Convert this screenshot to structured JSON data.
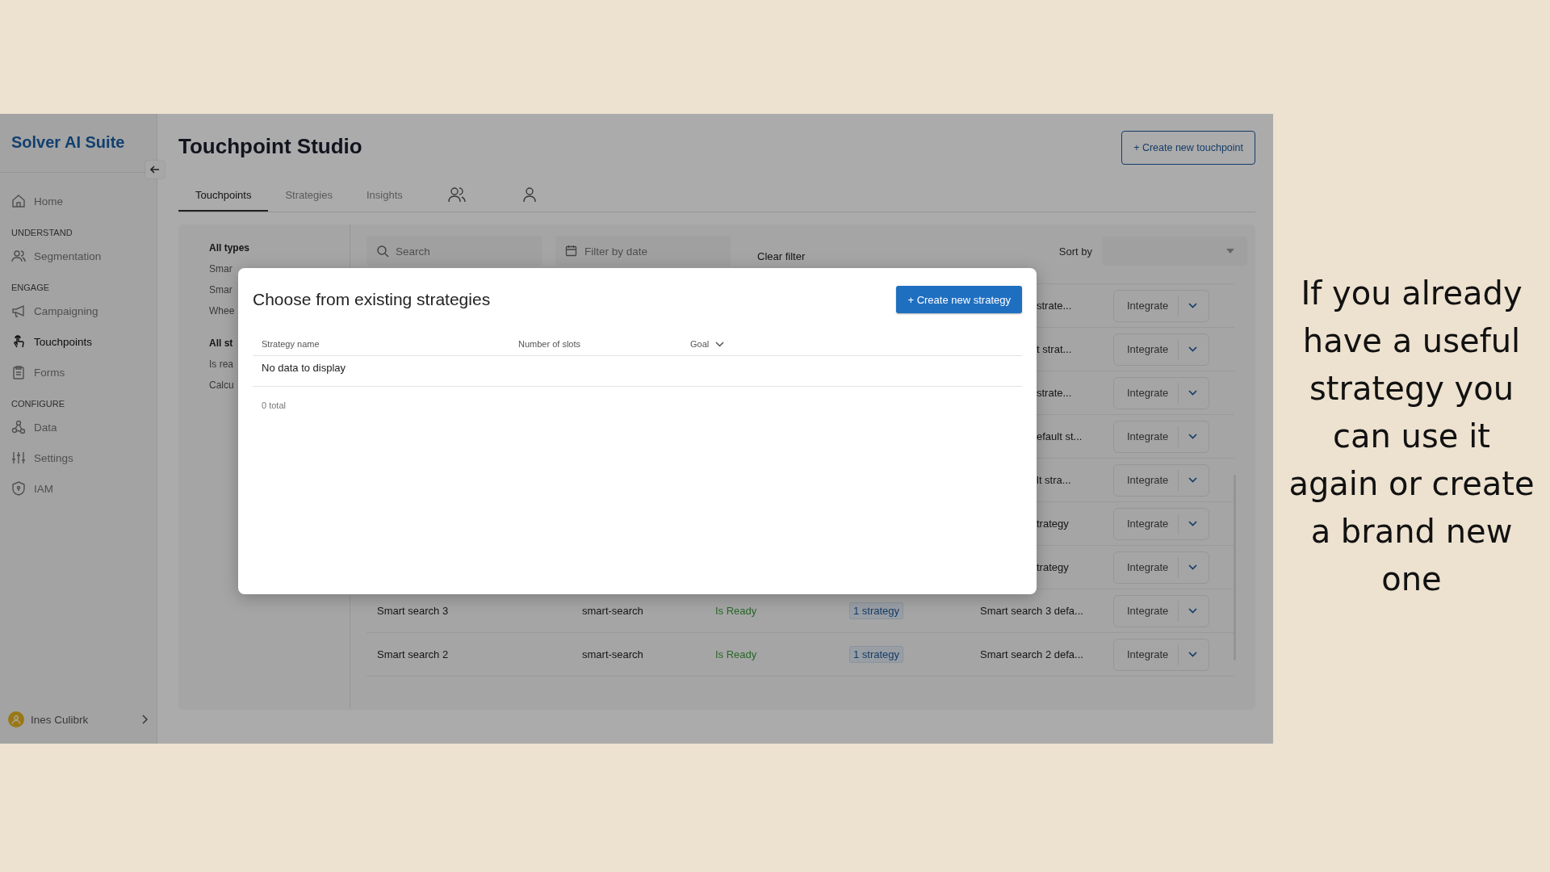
{
  "sidebar": {
    "brand": "Solver AI Suite",
    "sections": [
      {
        "items": [
          {
            "label": "Home",
            "selected": false
          }
        ]
      },
      {
        "heading": "UNDERSTAND",
        "items": [
          {
            "label": "Segmentation",
            "selected": false
          }
        ]
      },
      {
        "heading": "ENGAGE",
        "items": [
          {
            "label": "Campaigning",
            "selected": false
          },
          {
            "label": "Touchpoints",
            "selected": true
          },
          {
            "label": "Forms",
            "selected": false
          }
        ]
      },
      {
        "heading": "CONFIGURE",
        "items": [
          {
            "label": "Data",
            "selected": false
          },
          {
            "label": "Settings",
            "selected": false
          },
          {
            "label": "IAM",
            "selected": false
          }
        ]
      }
    ],
    "user": {
      "name": "Ines Culibrk"
    }
  },
  "page": {
    "title": "Touchpoint Studio",
    "create_button": "+ Create new touchpoint"
  },
  "tabs": [
    {
      "kind": "text",
      "label": "Touchpoints",
      "selected": true
    },
    {
      "kind": "text",
      "label": "Strategies",
      "selected": false
    },
    {
      "kind": "text",
      "label": "Insights",
      "selected": false
    },
    {
      "kind": "group",
      "selected": false
    },
    {
      "kind": "person",
      "selected": false
    }
  ],
  "filters": [
    {
      "heading": "All types",
      "items": [
        "Smar",
        "Smar",
        "Whee"
      ]
    },
    {
      "heading": "All st",
      "items": [
        "Is rea",
        "Calcu"
      ]
    }
  ],
  "toolbar": {
    "search": {
      "placeholder": "Search"
    },
    "date": {
      "placeholder": "Filter by date"
    },
    "clear": "Clear filter",
    "sort_label": "Sort by"
  },
  "rows": [
    {
      "kind": "covered",
      "default_strategy": "strate...",
      "action": "Integrate"
    },
    {
      "kind": "covered",
      "default_strategy": "t strat...",
      "action": "Integrate"
    },
    {
      "kind": "covered",
      "default_strategy": "strate...",
      "action": "Integrate"
    },
    {
      "kind": "covered",
      "default_strategy": "efault st...",
      "action": "Integrate"
    },
    {
      "kind": "covered",
      "default_strategy": "lt stra...",
      "action": "Integrate"
    },
    {
      "kind": "covered",
      "default_strategy": "trategy",
      "action": "Integrate"
    },
    {
      "kind": "covered",
      "default_strategy": "trategy",
      "action": "Integrate"
    },
    {
      "kind": "full",
      "name": "Smart search 3",
      "type": "smart-search",
      "status": "Is Ready",
      "strategies": "1 strategy",
      "default_strategy": "Smart search 3 defa...",
      "action": "Integrate"
    },
    {
      "kind": "full",
      "name": "Smart search 2",
      "type": "smart-search",
      "status": "Is Ready",
      "strategies": "1 strategy",
      "default_strategy": "Smart search 2 defa...",
      "action": "Integrate"
    }
  ],
  "modal": {
    "title": "Choose from existing strategies",
    "create_button": "+ Create new strategy",
    "columns": [
      {
        "label": "Strategy name",
        "dropdown": false
      },
      {
        "label": "Number of slots",
        "dropdown": false
      },
      {
        "label": "Goal",
        "dropdown": true
      }
    ],
    "empty": "No data to display",
    "total": "0 total"
  },
  "caption": "If you already have a useful strategy you can use it again or create a brand new one"
}
